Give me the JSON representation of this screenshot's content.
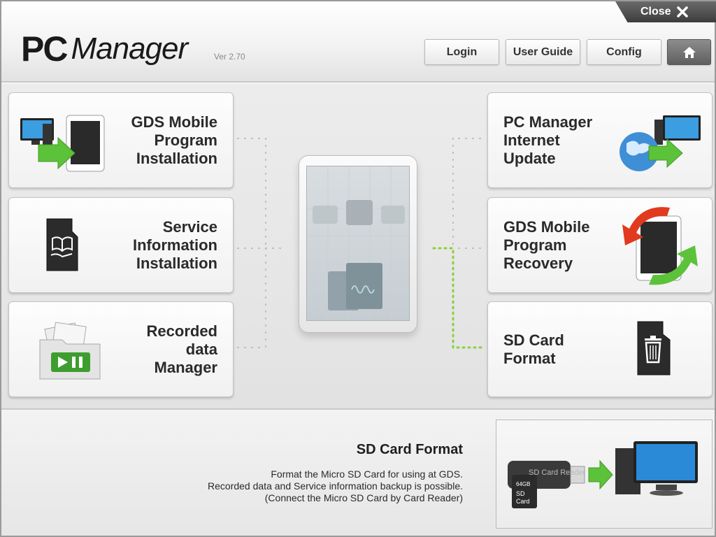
{
  "header": {
    "logo_pc": "PC",
    "logo_manager": "Manager",
    "version": "Ver 2.70",
    "close_label": "Close",
    "buttons": {
      "login": "Login",
      "user_guide": "User Guide",
      "config": "Config"
    },
    "icons": {
      "close": "close-x-icon",
      "home": "home-icon"
    }
  },
  "cards": {
    "left": [
      {
        "lines": [
          "GDS Mobile",
          "Program",
          "Installation"
        ],
        "icon": "pc-to-tablet-icon"
      },
      {
        "lines": [
          "Service",
          "Information",
          "Installation"
        ],
        "icon": "sd-card-book-icon"
      },
      {
        "lines": [
          "Recorded",
          "data",
          "Manager"
        ],
        "icon": "folder-play-icon"
      }
    ],
    "right": [
      {
        "lines": [
          "PC Manager",
          "Internet",
          "Update"
        ],
        "icon": "globe-to-pc-icon"
      },
      {
        "lines": [
          "GDS Mobile",
          "Program",
          "Recovery"
        ],
        "icon": "tablet-recovery-icon"
      },
      {
        "lines": [
          "SD Card",
          "Format"
        ],
        "icon": "sd-card-trash-icon"
      }
    ]
  },
  "info": {
    "title": "SD Card Format",
    "lines": [
      "Format the Micro SD Card for using at GDS.",
      "Recorded data and Service information backup is possible.",
      "(Connect the Micro SD Card by Card Reader)"
    ],
    "image_text": {
      "reader": "SD Card Reader",
      "card_size": "64GB",
      "card_label1": "SD",
      "card_label2": "Card"
    }
  },
  "colors": {
    "accent_green": "#8ccf3a",
    "arrow_red": "#e23a1e",
    "monitor_blue": "#2a8ad8"
  }
}
